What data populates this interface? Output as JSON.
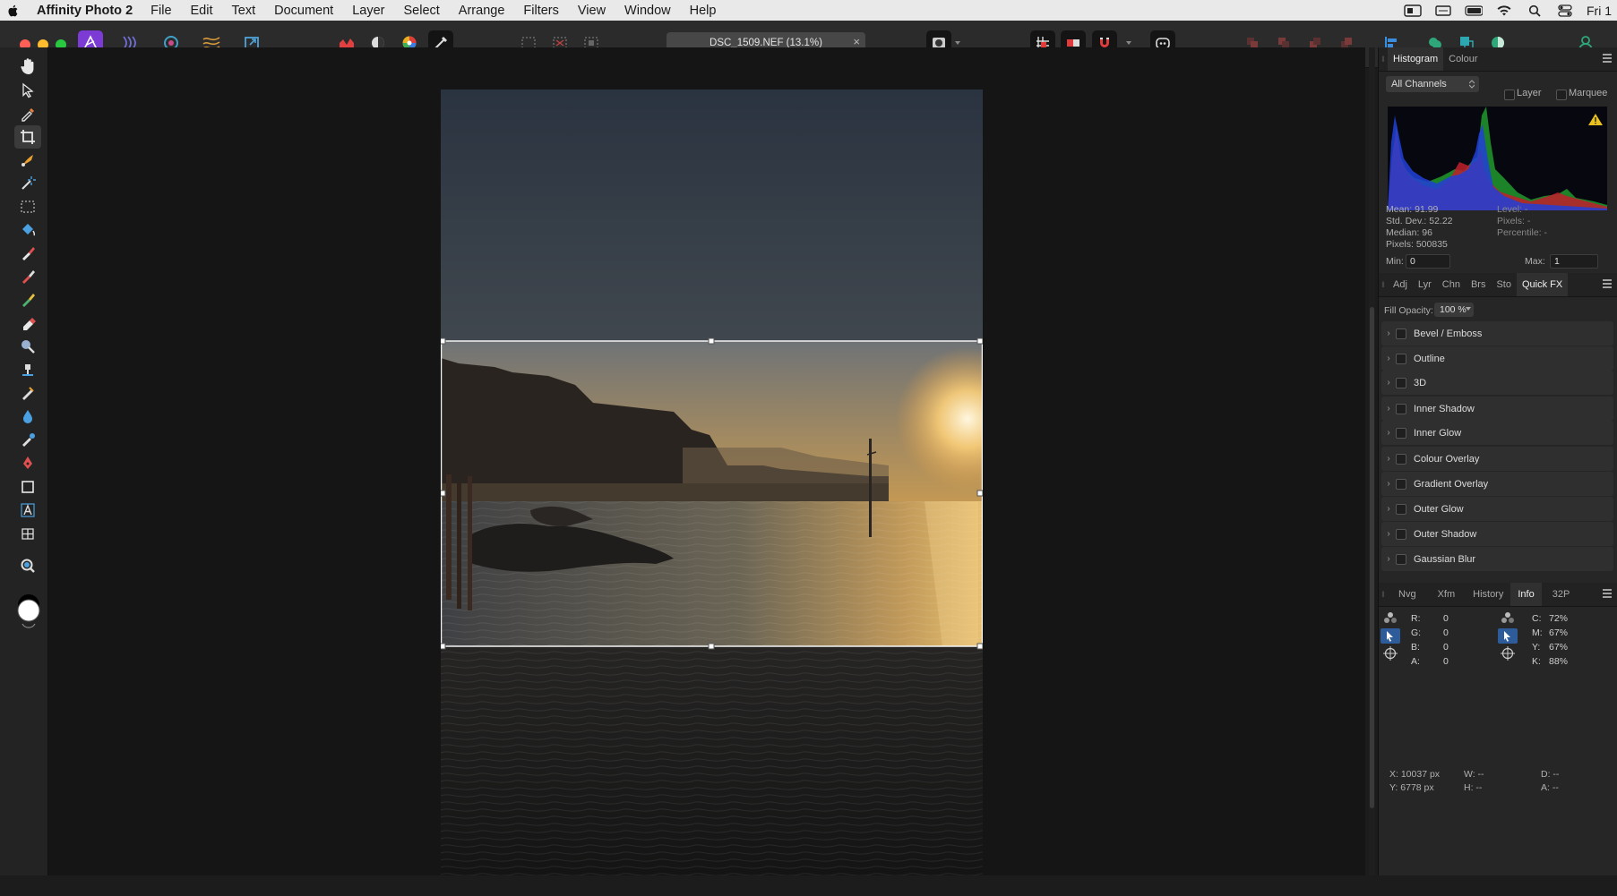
{
  "menubar": {
    "app_name": "Affinity Photo 2",
    "menus": [
      "File",
      "Edit",
      "Text",
      "Document",
      "Layer",
      "Select",
      "Arrange",
      "Filters",
      "View",
      "Window",
      "Help"
    ],
    "clock": "Fri 1"
  },
  "document": {
    "tab_title": "DSC_1509.NEF (13.1%)",
    "close_glyph": "×"
  },
  "histogram_panel": {
    "tabs": [
      "Histogram",
      "Colour"
    ],
    "channel": "All Channels",
    "layer_label": "Layer",
    "marquee_label": "Marquee",
    "stats": {
      "mean": "Mean: 91.99",
      "std_dev": "Std. Dev.: 52.22",
      "median": "Median: 96",
      "pixels": "Pixels: 500835",
      "level": "Level: -",
      "pixels_right": "Pixels: -",
      "percentile": "Percentile: -"
    },
    "min_label": "Min:",
    "min_value": "0",
    "max_label": "Max:",
    "max_value": "1"
  },
  "fx_panel": {
    "tabs": [
      "Adj",
      "Lyr",
      "Chn",
      "Brs",
      "Sto",
      "Quick FX"
    ],
    "fill_opacity_label": "Fill Opacity:",
    "fill_opacity_value": "100 %",
    "effects": [
      "Bevel / Emboss",
      "Outline",
      "3D",
      "Inner Shadow",
      "Inner Glow",
      "Colour Overlay",
      "Gradient Overlay",
      "Outer Glow",
      "Outer Shadow",
      "Gaussian Blur"
    ]
  },
  "info_panel": {
    "tabs": [
      "Nvg",
      "Xfm",
      "History",
      "Info",
      "32P"
    ],
    "rgba": [
      {
        "label": "R:",
        "value": "0"
      },
      {
        "label": "G:",
        "value": "0"
      },
      {
        "label": "B:",
        "value": "0"
      },
      {
        "label": "A:",
        "value": "0"
      }
    ],
    "cmyk": [
      {
        "label": "C:",
        "value": "72%"
      },
      {
        "label": "M:",
        "value": "67%"
      },
      {
        "label": "Y:",
        "value": "67%"
      },
      {
        "label": "K:",
        "value": "88%"
      }
    ],
    "cursor_x": "X: 10037 px",
    "cursor_y": "Y: 6778 px",
    "w": "W: --",
    "h": "H: --",
    "d": "D: --",
    "a": "A: --"
  },
  "colors": {
    "accent": "#7d3bd6",
    "selection_tab": "#2e5b9a"
  }
}
